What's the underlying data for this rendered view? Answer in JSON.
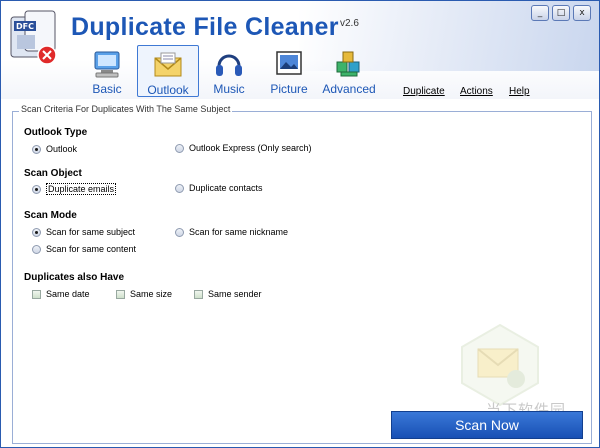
{
  "app": {
    "title": "Duplicate File Cleaner",
    "version": "v2.6",
    "logo_label": "DFC"
  },
  "window_controls": [
    "_",
    "□",
    "x"
  ],
  "toolbar": [
    {
      "label": "Basic",
      "icon": "computer-icon",
      "active": false
    },
    {
      "label": "Outlook",
      "icon": "envelope-icon",
      "active": true
    },
    {
      "label": "Music",
      "icon": "headphones-icon",
      "active": false
    },
    {
      "label": "Picture",
      "icon": "picture-icon",
      "active": false
    },
    {
      "label": "Advanced",
      "icon": "cubes-icon",
      "active": false
    }
  ],
  "menu": {
    "duplicate": "Duplicate",
    "actions": "Actions",
    "help": "Help"
  },
  "panel": {
    "legend": "Scan Criteria For Duplicates With The Same Subject"
  },
  "outlook_type": {
    "title": "Outlook Type",
    "options": [
      "Outlook",
      "Outlook Express (Only search)"
    ],
    "selected": "Outlook"
  },
  "scan_object": {
    "title": "Scan Object",
    "options": [
      "Duplicate emails",
      "Duplicate contacts"
    ],
    "selected": "Duplicate emails"
  },
  "scan_mode": {
    "title": "Scan Mode",
    "options": [
      "Scan for same subject",
      "Scan for same nickname",
      "Scan for same content"
    ],
    "selected": "Scan for same subject"
  },
  "duplicates_also": {
    "title": "Duplicates also Have",
    "options": [
      {
        "label": "Same date",
        "checked": false
      },
      {
        "label": "Same size",
        "checked": false
      },
      {
        "label": "Same sender",
        "checked": false
      }
    ]
  },
  "scan_button": "Scan Now",
  "watermark": {
    "text": "当下软件园"
  },
  "colors": {
    "accent": "#1d57b6",
    "button": "#1f5cc2",
    "panel_border": "#9aaed6"
  }
}
